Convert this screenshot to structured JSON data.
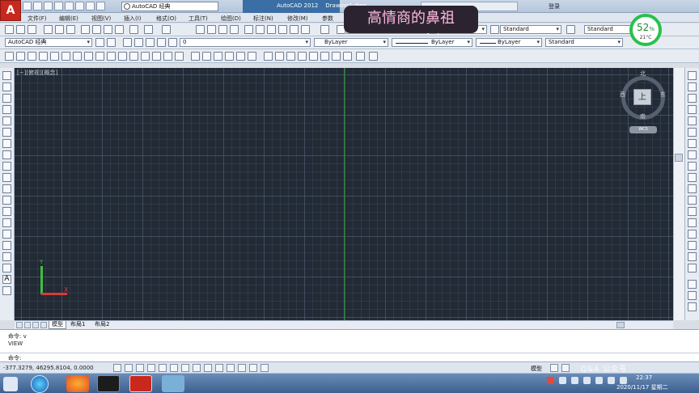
{
  "app": {
    "title": "AutoCAD 2012",
    "document": "Drawing1.dwg",
    "logo_letter": "A",
    "workspace": "AutoCAD 经典",
    "login": "登录"
  },
  "menu": [
    "文件(F)",
    "编辑(E)",
    "视图(V)",
    "插入(I)",
    "格式(O)",
    "工具(T)",
    "绘图(D)",
    "标注(N)",
    "修改(M)",
    "参数"
  ],
  "toolbar": {
    "text_style": "Standard",
    "dim_style": "Standard",
    "table_style": "Standard",
    "layer_workspace": "AutoCAD 经典",
    "layer_name": "0",
    "color": "ByLayer",
    "linetype": "ByLayer",
    "lineweight": "ByLayer",
    "plot_style": "Standard"
  },
  "overlay": {
    "banner_text": "高情商的鼻祖",
    "cpu_percent": "52",
    "cpu_percent_suffix": "%",
    "temperature": "21°C"
  },
  "viewport": {
    "label": "[−][俯视][概念]",
    "viewcube_face": "上",
    "north": "北",
    "south": "南",
    "east": "东",
    "west": "西",
    "wcs": "WCS"
  },
  "ucs": {
    "x": "X",
    "y": "Y"
  },
  "tabs": [
    "模型",
    "布局1",
    "布局2"
  ],
  "command": {
    "line1": "命令: v",
    "line2": "VIEW",
    "prompt": "命令:"
  },
  "status": {
    "coords": "-377.3279,  46295.8104, 0.0000",
    "model": "模型"
  },
  "watermark": "Q&A 公众号",
  "clock": {
    "time": "22:37",
    "date": "2020/11/17 星期二"
  },
  "colors": {
    "canvas": "#222a35",
    "ucs_x": "#d83a3a",
    "ucs_y": "#3fbf3f",
    "crosshair": "#2e8b3a",
    "cpu_ring": "#27c24c",
    "banner_text": "#ffb9e0"
  }
}
